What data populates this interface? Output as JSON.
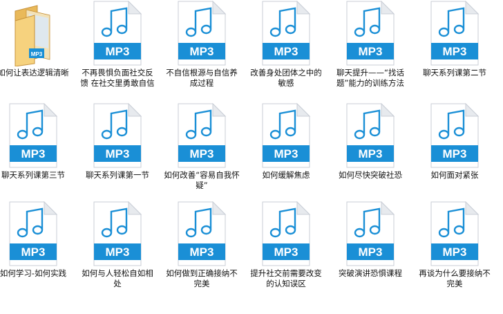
{
  "colors": {
    "accent": "#1a8fd6",
    "paper": "#ffffff",
    "paper_edge": "#c9ced6",
    "fold": "#e7eaee",
    "folder_back": "#e9b95a",
    "folder_front": "#f6d27e"
  },
  "items": [
    {
      "icon": "folder-archive-icon",
      "badge": "MP3",
      "label": "如何让表达逻辑清晰"
    },
    {
      "icon": "mp3-file-icon",
      "badge": "MP3",
      "label": "不再畏惧负面社交反馈 在社交里勇敢自信"
    },
    {
      "icon": "mp3-file-icon",
      "badge": "MP3",
      "label": "不自信根源与自信养成过程"
    },
    {
      "icon": "mp3-file-icon",
      "badge": "MP3",
      "label": "改善身处团体之中的敏感"
    },
    {
      "icon": "mp3-file-icon",
      "badge": "MP3",
      "label": "聊天提升——“找话题”能力的训练方法"
    },
    {
      "icon": "mp3-file-icon",
      "badge": "MP3",
      "label": "聊天系列课第二节"
    },
    {
      "icon": "mp3-file-icon",
      "badge": "MP3",
      "label": "聊天系列课第三节"
    },
    {
      "icon": "mp3-file-icon",
      "badge": "MP3",
      "label": "聊天系列课第一节"
    },
    {
      "icon": "mp3-file-icon",
      "badge": "MP3",
      "label": "如何改善“容易自我怀疑”"
    },
    {
      "icon": "mp3-file-icon",
      "badge": "MP3",
      "label": "如何缓解焦虑"
    },
    {
      "icon": "mp3-file-icon",
      "badge": "MP3",
      "label": "如何尽快突破社恐"
    },
    {
      "icon": "mp3-file-icon",
      "badge": "MP3",
      "label": "如何面对紧张"
    },
    {
      "icon": "mp3-file-icon",
      "badge": "MP3",
      "label": "如何学习-如何实践"
    },
    {
      "icon": "mp3-file-icon",
      "badge": "MP3",
      "label": "如何与人轻松自如相处"
    },
    {
      "icon": "mp3-file-icon",
      "badge": "MP3",
      "label": "如何做到正确接纳不完美"
    },
    {
      "icon": "mp3-file-icon",
      "badge": "MP3",
      "label": "提升社交前需要改变的认知误区"
    },
    {
      "icon": "mp3-file-icon",
      "badge": "MP3",
      "label": "突破演讲恐惧课程"
    },
    {
      "icon": "mp3-file-icon",
      "badge": "MP3",
      "label": "再谈为什么要接纳不完美"
    }
  ]
}
